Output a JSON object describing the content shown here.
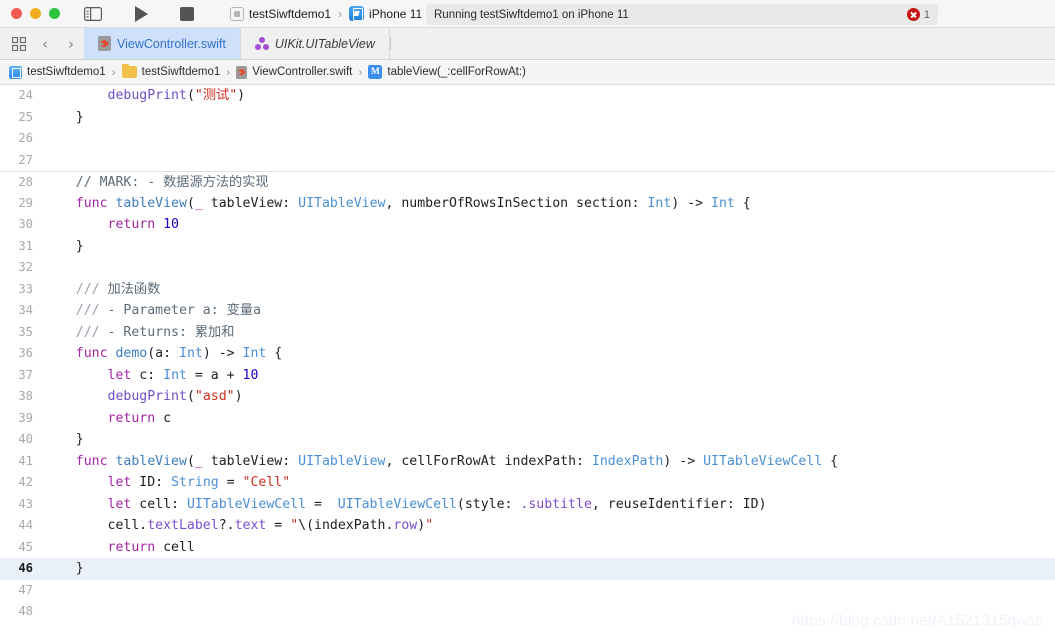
{
  "toolbar": {
    "window_controls": [
      "close",
      "minimize",
      "zoom"
    ],
    "sidebar_toggle_label": "Navigator Toggle",
    "run_label": "Run",
    "stop_label": "Stop",
    "scheme_name": "testSiwftdemo1",
    "destination_name": "iPhone 11",
    "status_text": "Running testSiwftdemo1 on iPhone 11",
    "error_count": "1"
  },
  "tabbar": {
    "grid_icon": "grid-icon",
    "back_icon": "‹",
    "forward_icon": "›",
    "tabs": [
      {
        "label": "ViewController.swift",
        "icon": "swift-file-icon",
        "active": true
      },
      {
        "label": "UIKit.UITableView",
        "icon": "framework-icon",
        "active": false
      }
    ]
  },
  "breadcrumb": {
    "items": [
      {
        "label": "testSiwftdemo1",
        "icon": "project-icon"
      },
      {
        "label": "testSiwftdemo1",
        "icon": "folder-icon"
      },
      {
        "label": "ViewController.swift",
        "icon": "swift-file-icon"
      },
      {
        "label": "tableView(_:cellForRowAt:)",
        "icon": "method-icon"
      }
    ],
    "separator": "›"
  },
  "editor": {
    "first_line": 24,
    "current_line": 46,
    "watermark": "https://blog.csdn.net/A1521315qwss",
    "lines": [
      {
        "n": "24",
        "indent": 8,
        "tokens": [
          {
            "t": "debugPrint",
            "c": "call"
          },
          {
            "t": "(",
            "c": ""
          },
          {
            "t": "\"测试\"",
            "c": "str"
          },
          {
            "t": ")",
            "c": ""
          }
        ]
      },
      {
        "n": "25",
        "indent": 4,
        "tokens": [
          {
            "t": "}",
            "c": ""
          }
        ]
      },
      {
        "n": "26",
        "indent": 0,
        "tokens": []
      },
      {
        "n": "27",
        "indent": 0,
        "tokens": []
      },
      {
        "n": "28",
        "indent": 4,
        "sep": true,
        "tokens": [
          {
            "t": "// MARK: - 数据源方法的实现",
            "c": "cmt"
          }
        ]
      },
      {
        "n": "29",
        "indent": 4,
        "tokens": [
          {
            "t": "func ",
            "c": "kw"
          },
          {
            "t": "tableView",
            "c": "fn"
          },
          {
            "t": "(",
            "c": ""
          },
          {
            "t": "_",
            "c": "kw"
          },
          {
            "t": " tableView: ",
            "c": ""
          },
          {
            "t": "UITableView",
            "c": "typ"
          },
          {
            "t": ", numberOfRowsInSection section: ",
            "c": ""
          },
          {
            "t": "Int",
            "c": "typ"
          },
          {
            "t": ") -> ",
            "c": ""
          },
          {
            "t": "Int",
            "c": "typ"
          },
          {
            "t": " {",
            "c": ""
          }
        ]
      },
      {
        "n": "30",
        "indent": 8,
        "tokens": [
          {
            "t": "return ",
            "c": "kw"
          },
          {
            "t": "10",
            "c": "num"
          }
        ]
      },
      {
        "n": "31",
        "indent": 4,
        "tokens": [
          {
            "t": "}",
            "c": ""
          }
        ]
      },
      {
        "n": "32",
        "indent": 0,
        "tokens": []
      },
      {
        "n": "33",
        "indent": 4,
        "tokens": [
          {
            "t": "///",
            "c": "docslash"
          },
          {
            "t": " 加法函数",
            "c": "doc"
          }
        ]
      },
      {
        "n": "34",
        "indent": 4,
        "tokens": [
          {
            "t": "///",
            "c": "docslash"
          },
          {
            "t": " - Parameter a: 变量a",
            "c": "doc"
          }
        ]
      },
      {
        "n": "35",
        "indent": 4,
        "tokens": [
          {
            "t": "///",
            "c": "docslash"
          },
          {
            "t": " - Returns: 累加和",
            "c": "doc"
          }
        ]
      },
      {
        "n": "36",
        "indent": 4,
        "tokens": [
          {
            "t": "func ",
            "c": "kw"
          },
          {
            "t": "demo",
            "c": "fn"
          },
          {
            "t": "(a: ",
            "c": ""
          },
          {
            "t": "Int",
            "c": "typ"
          },
          {
            "t": ") -> ",
            "c": ""
          },
          {
            "t": "Int",
            "c": "typ"
          },
          {
            "t": " {",
            "c": ""
          }
        ]
      },
      {
        "n": "37",
        "indent": 8,
        "tokens": [
          {
            "t": "let ",
            "c": "kw"
          },
          {
            "t": "c: ",
            "c": ""
          },
          {
            "t": "Int",
            "c": "typ"
          },
          {
            "t": " = a + ",
            "c": ""
          },
          {
            "t": "10",
            "c": "num"
          }
        ]
      },
      {
        "n": "38",
        "indent": 8,
        "tokens": [
          {
            "t": "debugPrint",
            "c": "call"
          },
          {
            "t": "(",
            "c": ""
          },
          {
            "t": "\"asd\"",
            "c": "str"
          },
          {
            "t": ")",
            "c": ""
          }
        ]
      },
      {
        "n": "39",
        "indent": 8,
        "tokens": [
          {
            "t": "return ",
            "c": "kw"
          },
          {
            "t": "c",
            "c": ""
          }
        ]
      },
      {
        "n": "40",
        "indent": 4,
        "tokens": [
          {
            "t": "}",
            "c": ""
          }
        ]
      },
      {
        "n": "41",
        "indent": 4,
        "tokens": [
          {
            "t": "func ",
            "c": "kw"
          },
          {
            "t": "tableView",
            "c": "fn"
          },
          {
            "t": "(",
            "c": ""
          },
          {
            "t": "_",
            "c": "kw"
          },
          {
            "t": " tableView: ",
            "c": ""
          },
          {
            "t": "UITableView",
            "c": "typ"
          },
          {
            "t": ", cellForRowAt indexPath: ",
            "c": ""
          },
          {
            "t": "IndexPath",
            "c": "typ"
          },
          {
            "t": ") -> ",
            "c": ""
          },
          {
            "t": "UITableViewCell",
            "c": "typ"
          },
          {
            "t": " {",
            "c": ""
          }
        ]
      },
      {
        "n": "42",
        "indent": 8,
        "tokens": [
          {
            "t": "let ",
            "c": "kw"
          },
          {
            "t": "ID: ",
            "c": ""
          },
          {
            "t": "String",
            "c": "typ"
          },
          {
            "t": " = ",
            "c": ""
          },
          {
            "t": "\"Cell\"",
            "c": "str"
          }
        ]
      },
      {
        "n": "43",
        "indent": 8,
        "tokens": [
          {
            "t": "let ",
            "c": "kw"
          },
          {
            "t": "cell: ",
            "c": ""
          },
          {
            "t": "UITableViewCell",
            "c": "typ"
          },
          {
            "t": " =  ",
            "c": ""
          },
          {
            "t": "UITableViewCell",
            "c": "typ"
          },
          {
            "t": "(style: ",
            "c": ""
          },
          {
            "t": ".subtitle",
            "c": "prop"
          },
          {
            "t": ", reuseIdentifier: ID)",
            "c": ""
          }
        ]
      },
      {
        "n": "44",
        "indent": 8,
        "tokens": [
          {
            "t": "cell.",
            "c": ""
          },
          {
            "t": "textLabel",
            "c": "prop"
          },
          {
            "t": "?.",
            "c": ""
          },
          {
            "t": "text",
            "c": "prop"
          },
          {
            "t": " = ",
            "c": ""
          },
          {
            "t": "\"",
            "c": "str"
          },
          {
            "t": "\\(indexPath.",
            "c": ""
          },
          {
            "t": "row",
            "c": "prop"
          },
          {
            "t": ")",
            "c": ""
          },
          {
            "t": "\"",
            "c": "str"
          }
        ]
      },
      {
        "n": "45",
        "indent": 8,
        "tokens": [
          {
            "t": "return ",
            "c": "kw"
          },
          {
            "t": "cell",
            "c": ""
          }
        ]
      },
      {
        "n": "46",
        "indent": 4,
        "current": true,
        "tokens": [
          {
            "t": "}",
            "c": ""
          }
        ]
      },
      {
        "n": "47",
        "indent": 0,
        "tokens": []
      },
      {
        "n": "48",
        "indent": 0,
        "tokens": []
      }
    ]
  }
}
